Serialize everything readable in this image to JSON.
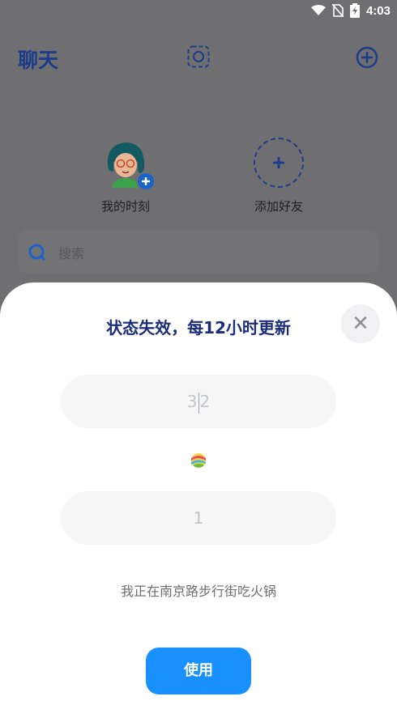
{
  "status_bar": {
    "time": "4:03",
    "icons": [
      "wifi-icon",
      "no-sim-icon",
      "battery-charging-icon"
    ]
  },
  "header": {
    "title": "聊天",
    "scan_icon": "scan-icon",
    "add_icon": "plus-circle-icon"
  },
  "stories": [
    {
      "label": "我的时刻",
      "icon": "avatar-with-plus"
    },
    {
      "label": "添加好友",
      "icon": "plus-icon"
    }
  ],
  "search": {
    "placeholder": "搜索"
  },
  "sheet": {
    "title": "状态失效，每12小时更新",
    "close_icon": "close-icon",
    "input_top": {
      "value_left": "3",
      "value_right": "2"
    },
    "emoji_icon": "beach-ball-emoji",
    "input_bottom": {
      "value": "1"
    },
    "status_text": "我正在南京路步行街吃火锅",
    "use_button": "使用"
  },
  "colors": {
    "primary_blue": "#1890ff",
    "title_navy": "#1b2d7a",
    "overlay_gray": "#6f6f72"
  }
}
